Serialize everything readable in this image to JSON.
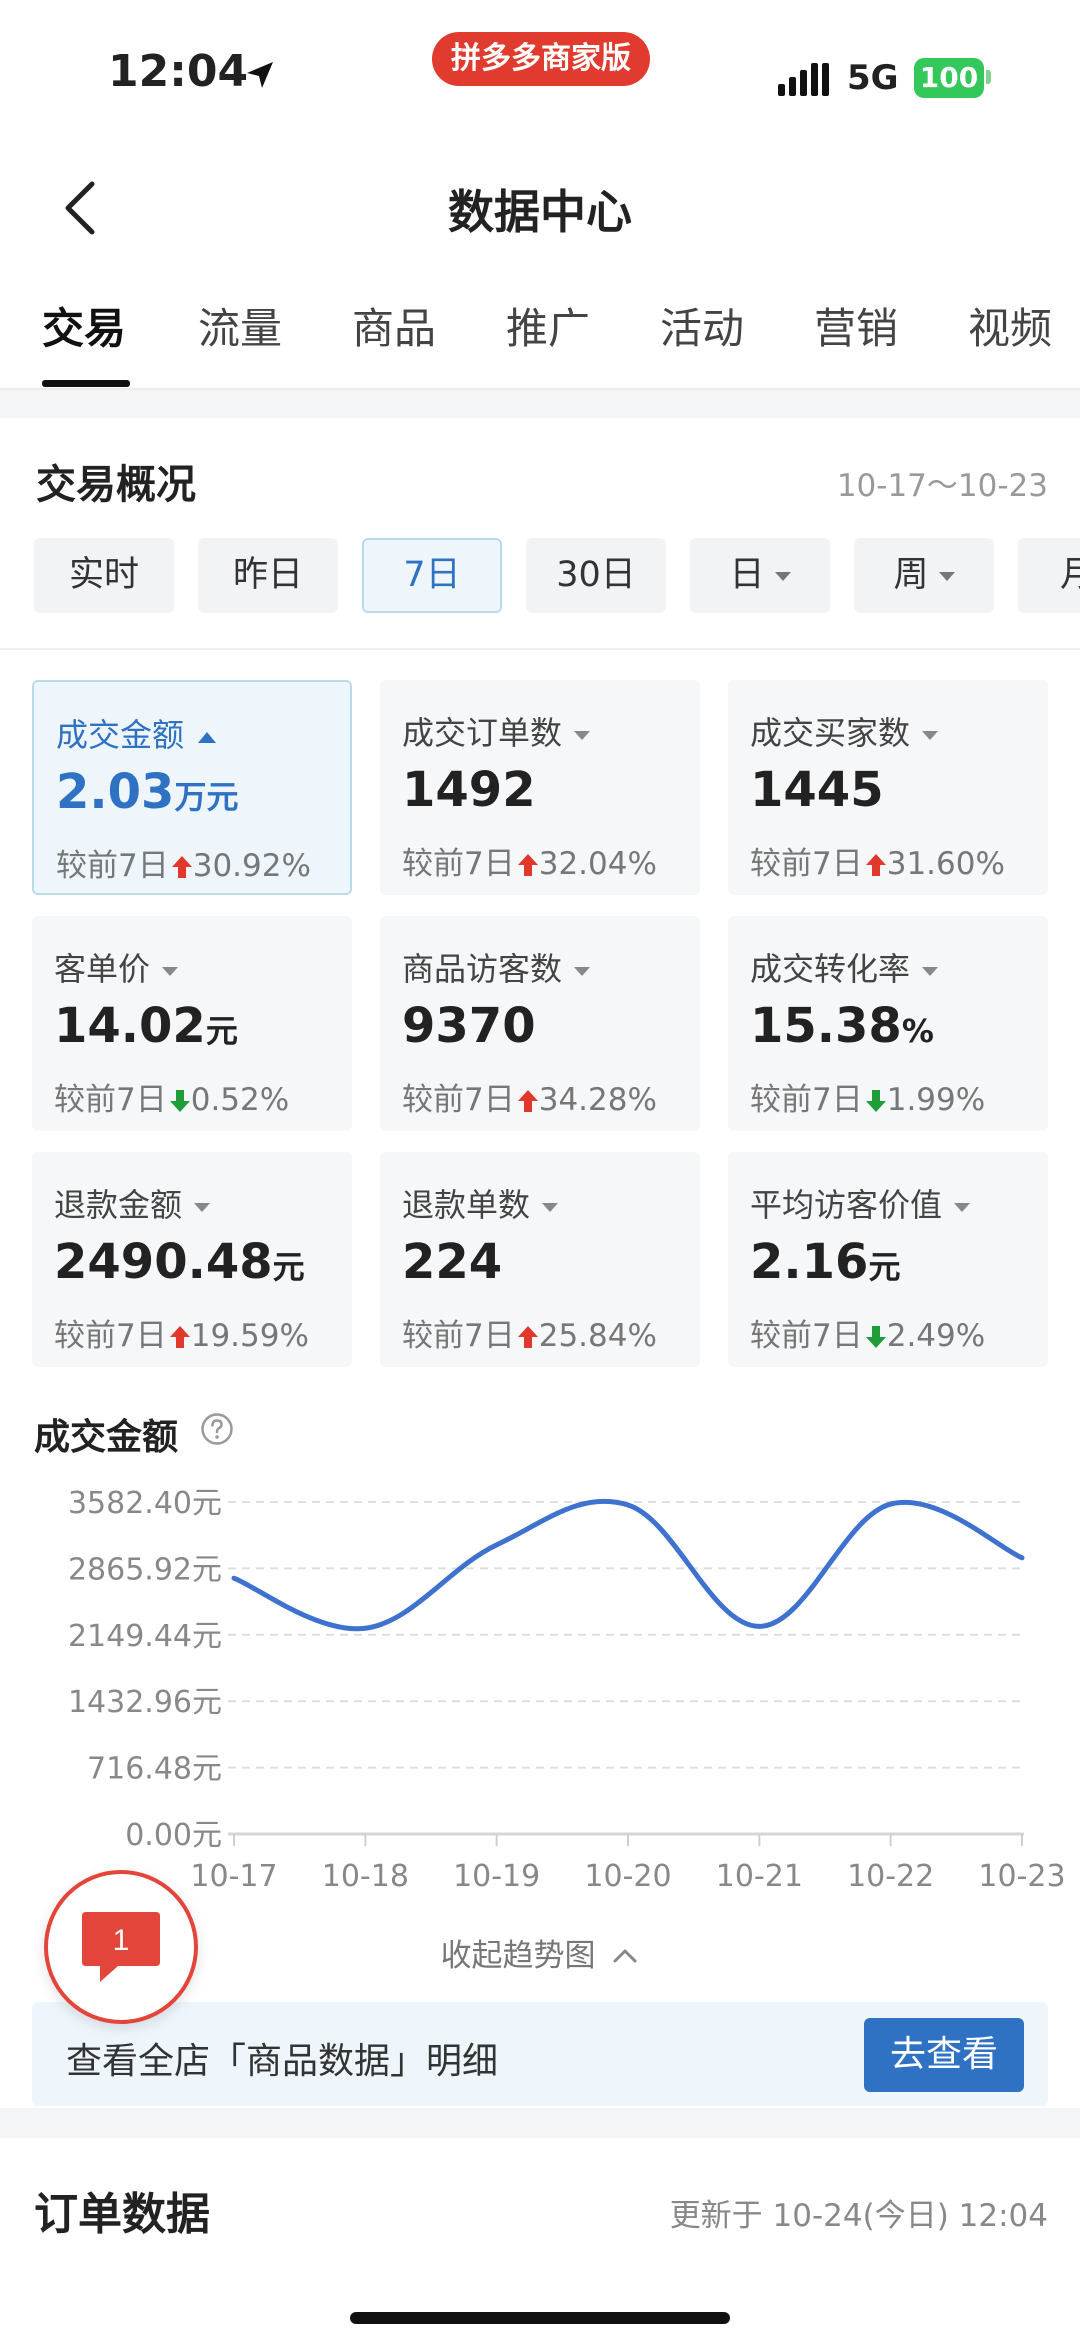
{
  "status_bar": {
    "time": "12:04",
    "app_pill": "拼多多商家版",
    "network": "5G",
    "battery": "100"
  },
  "nav": {
    "title": "数据中心"
  },
  "tabs": [
    "交易",
    "流量",
    "商品",
    "推广",
    "活动",
    "营销",
    "视频"
  ],
  "overview": {
    "title": "交易概况",
    "date_range": "10-17～10-23",
    "periods": [
      "实时",
      "昨日",
      "7日",
      "30日",
      "日",
      "周",
      "月"
    ],
    "active_period": "7日"
  },
  "metrics": [
    {
      "label": "成交金额",
      "value": "2.03",
      "unit": "万元",
      "compare_prefix": "较前7日",
      "change": "30.92%",
      "direction": "up"
    },
    {
      "label": "成交订单数",
      "value": "1492",
      "unit": "",
      "compare_prefix": "较前7日",
      "change": "32.04%",
      "direction": "up"
    },
    {
      "label": "成交买家数",
      "value": "1445",
      "unit": "",
      "compare_prefix": "较前7日",
      "change": "31.60%",
      "direction": "up"
    },
    {
      "label": "客单价",
      "value": "14.02",
      "unit": "元",
      "compare_prefix": "较前7日",
      "change": "0.52%",
      "direction": "down"
    },
    {
      "label": "商品访客数",
      "value": "9370",
      "unit": "",
      "compare_prefix": "较前7日",
      "change": "34.28%",
      "direction": "up"
    },
    {
      "label": "成交转化率",
      "value": "15.38",
      "unit": "%",
      "compare_prefix": "较前7日",
      "change": "1.99%",
      "direction": "down"
    },
    {
      "label": "退款金额",
      "value": "2490.48",
      "unit": "元",
      "compare_prefix": "较前7日",
      "change": "19.59%",
      "direction": "up"
    },
    {
      "label": "退款单数",
      "value": "224",
      "unit": "",
      "compare_prefix": "较前7日",
      "change": "25.84%",
      "direction": "up"
    },
    {
      "label": "平均访客价值",
      "value": "2.16",
      "unit": "元",
      "compare_prefix": "较前7日",
      "change": "2.49%",
      "direction": "down"
    }
  ],
  "chart_section": {
    "title": "成交金额",
    "collapse_label": "收起趋势图",
    "banner_text": "查看全店「商品数据」明细",
    "banner_button": "去查看"
  },
  "float_badge": {
    "count": "1"
  },
  "order_section": {
    "title": "订单数据",
    "updated": "更新于 10-24(今日) 12:04"
  },
  "colors": {
    "accent": "#2f72c4",
    "up": "#e0392b",
    "down": "#1f9d3a",
    "brand_red": "#e03b2e",
    "line": "#3f72cf"
  },
  "chart_data": {
    "type": "line",
    "title": "成交金额",
    "categories": [
      "10-17",
      "10-18",
      "10-19",
      "10-20",
      "10-21",
      "10-22",
      "10-23"
    ],
    "series": [
      {
        "values": [
          2760,
          2220,
          3120,
          3550,
          2240,
          3560,
          2980
        ]
      }
    ],
    "y_ticks": [
      "0.00元",
      "716.48元",
      "1432.96元",
      "2149.44元",
      "2865.92元",
      "3582.40元"
    ],
    "ylim": [
      0,
      3582.4
    ],
    "grid": true
  }
}
